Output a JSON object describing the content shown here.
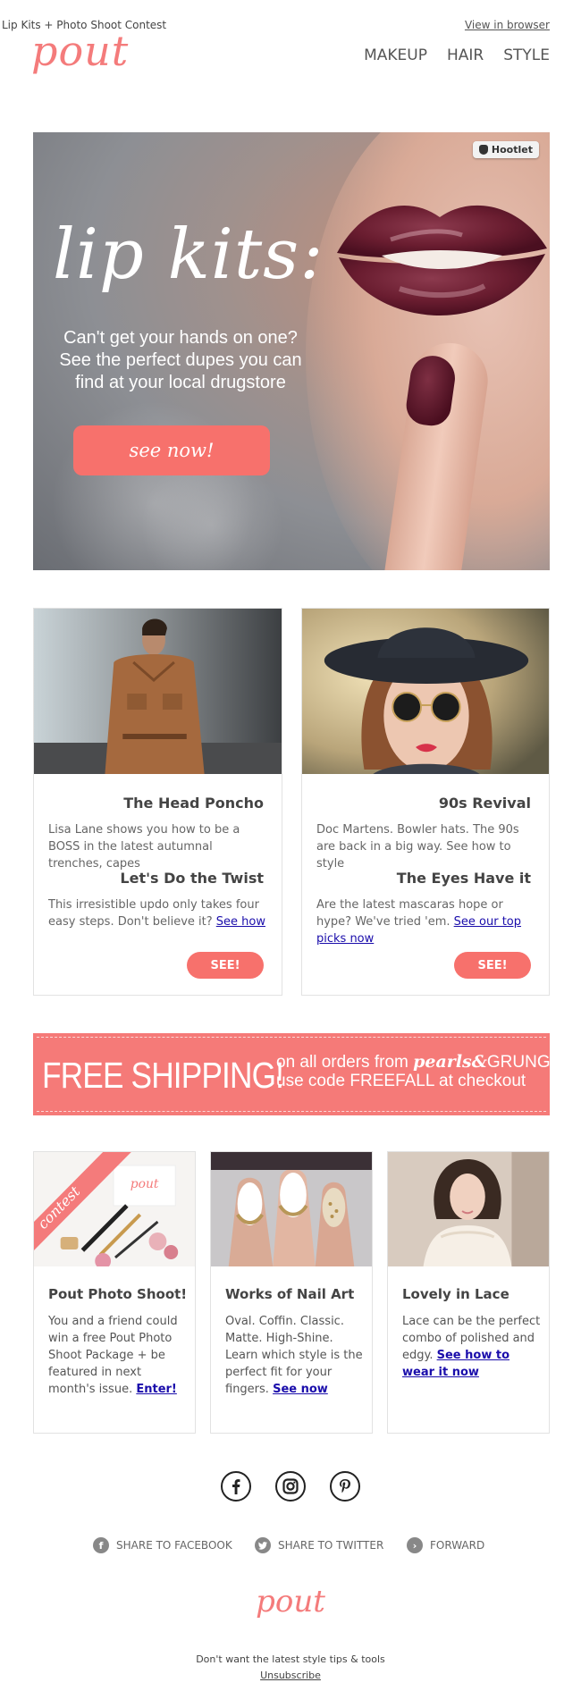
{
  "header": {
    "preheader": "Lip Kits + Photo Shoot Contest",
    "view_in_browser": "View in browser",
    "logo": "pout",
    "nav": [
      "MAKEUP",
      "HAIR",
      "STYLE"
    ]
  },
  "hero": {
    "badge": "Hootlet",
    "title": "lip kits:",
    "subtitle": "Can't get your hands on one? See the perfect dupes you can find at your local drugstore",
    "button": "see now!"
  },
  "features": [
    {
      "title1": "The Head Poncho",
      "text1": "Lisa Lane shows you how to be a BOSS in the latest autumnal trenches, capes",
      "title2": "Let's Do the Twist",
      "text2": "This irresistible updo only takes four easy steps. Don't believe it?",
      "link": "See how",
      "button": "SEE!"
    },
    {
      "title1": "90s Revival",
      "text1": "Doc Martens. Bowler hats. The 90s are back in a big way. See how to style",
      "title2": "The Eyes Have it",
      "text2": "Are the latest mascaras hope or hype? We've tried 'em.",
      "link": "See our top picks now",
      "button": "SEE!"
    }
  ],
  "shipping": {
    "headline": "FREE SHIPPING!",
    "line1_pre": "on all orders from",
    "brand_italic": "pearls&",
    "brand_caps": "GRUNGE",
    "line2": "use code FREEFALL at checkout"
  },
  "cards": [
    {
      "ribbon": "contest",
      "mini_logo": "pout",
      "title": "Pout Photo Shoot!",
      "text": "You and a friend could win a free Pout Photo Shoot Package + be featured in next month's issue.",
      "link": "Enter!"
    },
    {
      "title": "Works of Nail Art",
      "text": "Oval. Coffin. Classic. Matte. High-Shine. Learn which style is the perfect fit for your fingers.",
      "link": "See now"
    },
    {
      "title": "Lovely in Lace",
      "text": "Lace can be the perfect combo of polished and edgy.",
      "link": "See how to wear it now"
    }
  ],
  "share": {
    "facebook": "SHARE TO FACEBOOK",
    "twitter": "SHARE TO TWITTER",
    "forward": "FORWARD"
  },
  "footer": {
    "logo": "pout",
    "text": "Don't want the latest style tips & tools",
    "unsubscribe": "Unsubscribe"
  },
  "colors": {
    "accent": "#f7716c",
    "logo": "#f47b7b",
    "link": "#1a0dab"
  }
}
